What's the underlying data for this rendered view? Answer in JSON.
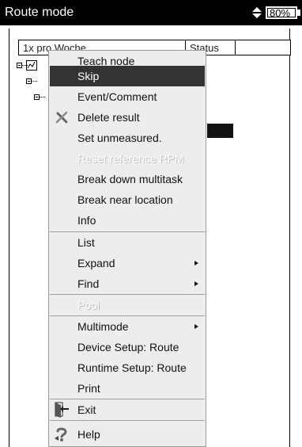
{
  "titlebar": {
    "title": "Route mode",
    "battery_level": "80%",
    "charge_icon": "charging-arrows-icon",
    "battery_icon": "battery-icon"
  },
  "table": {
    "col_week": "1x pro Woche",
    "col_status": "Status"
  },
  "menu": {
    "items": [
      {
        "label": "Teach node",
        "state": "normal"
      },
      {
        "label": "Skip",
        "state": "selected"
      },
      {
        "label": "Event/Comment",
        "state": "normal"
      },
      {
        "label": "Delete result",
        "state": "normal",
        "icon": "delete-x-icon"
      },
      {
        "label": "Set unmeasured.",
        "state": "normal"
      },
      {
        "label": "Reset reference RPM",
        "state": "disabled"
      },
      {
        "label": "Break down multitask",
        "state": "normal"
      },
      {
        "label": "Break near location",
        "state": "normal"
      },
      {
        "label": "Info",
        "state": "normal"
      },
      {
        "label": "List",
        "state": "normal"
      },
      {
        "label": "Expand",
        "state": "submenu"
      },
      {
        "label": "Find",
        "state": "submenu"
      },
      {
        "label": "Pool",
        "state": "disabled"
      },
      {
        "label": "Multimode",
        "state": "submenu"
      },
      {
        "label": "Device Setup: Route",
        "state": "normal"
      },
      {
        "label": "Runtime Setup: Route",
        "state": "normal"
      },
      {
        "label": "Print",
        "state": "normal"
      },
      {
        "label": "Exit",
        "state": "normal",
        "icon": "exit-door-icon"
      },
      {
        "label": "Help",
        "state": "normal",
        "icon": "help-question-icon"
      }
    ]
  },
  "colors": {
    "titlebar_bg": "#000000",
    "menu_bg": "#ededed",
    "selected_bg": "#333333",
    "disabled_text": "#ffffff"
  }
}
